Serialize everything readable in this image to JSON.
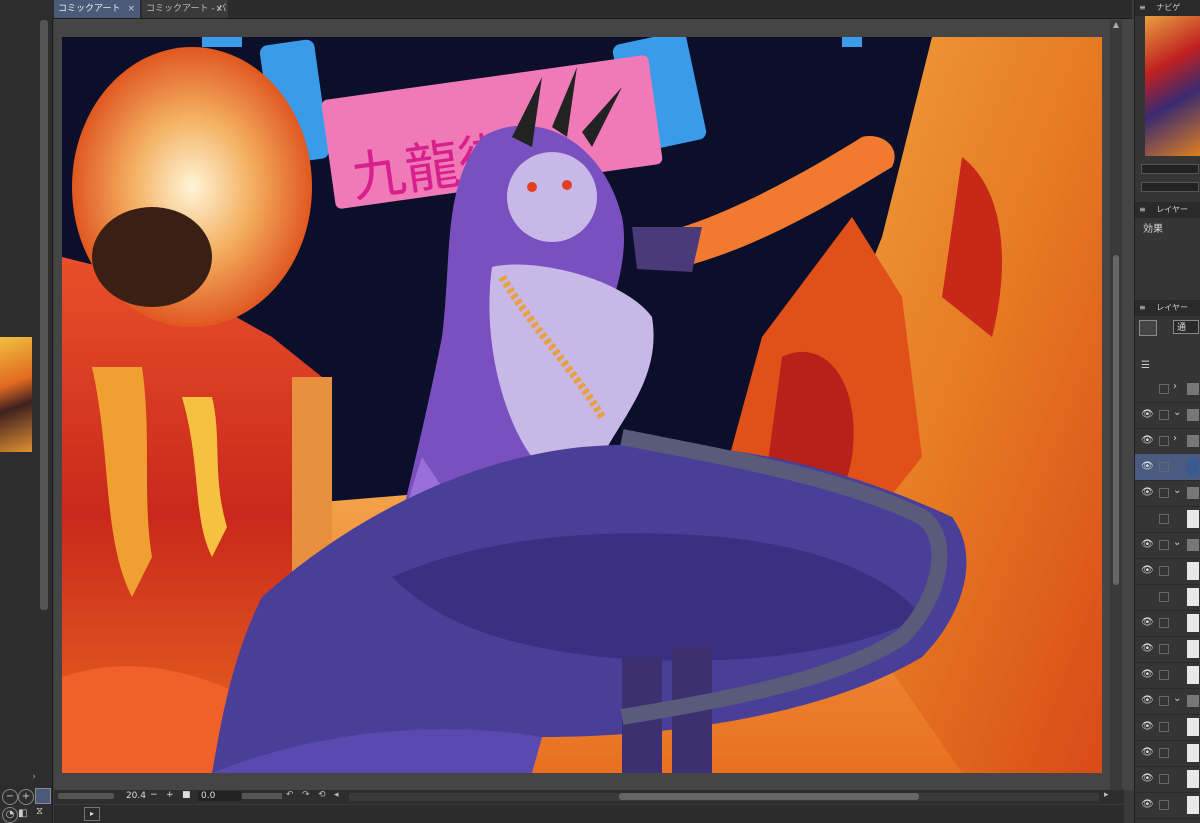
{
  "tabs": [
    {
      "label": "コミックアート",
      "close": "×"
    },
    {
      "label": "コミックアート - パ",
      "close": "×"
    }
  ],
  "artwork": {
    "sign_text": "九龍街"
  },
  "status": {
    "zoom": "20.4",
    "angle": "0.0",
    "minus": "−",
    "plus": "+",
    "reset": "■"
  },
  "right_panel": {
    "navigator_title": "ナビゲ",
    "layer_property_title": "レイヤー",
    "effect_label": "効果",
    "layer_panel_title": "レイヤー",
    "blend_mode": "通"
  },
  "layers": [
    {
      "visible": false,
      "type": "folder",
      "expanded": false
    },
    {
      "visible": true,
      "type": "folder",
      "expanded": true
    },
    {
      "visible": true,
      "type": "folder",
      "expanded": false
    },
    {
      "visible": true,
      "type": "raster",
      "selected": true
    },
    {
      "visible": true,
      "type": "folder",
      "expanded": true
    },
    {
      "visible": false,
      "type": "raster"
    },
    {
      "visible": true,
      "type": "folder",
      "expanded": true
    },
    {
      "visible": true,
      "type": "raster"
    },
    {
      "visible": false,
      "type": "raster"
    },
    {
      "visible": true,
      "type": "raster"
    },
    {
      "visible": true,
      "type": "raster"
    },
    {
      "visible": true,
      "type": "raster"
    },
    {
      "visible": true,
      "type": "folder",
      "expanded": true
    },
    {
      "visible": true,
      "type": "raster"
    },
    {
      "visible": true,
      "type": "raster"
    },
    {
      "visible": true,
      "type": "raster"
    },
    {
      "visible": true,
      "type": "raster"
    }
  ]
}
